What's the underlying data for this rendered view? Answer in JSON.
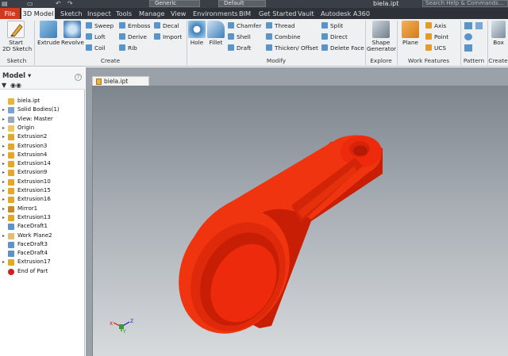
{
  "titlebar": {
    "quick_access": [
      "▤",
      "▭",
      "↶",
      "↷"
    ],
    "material": "Generic",
    "appearance": "Default",
    "doc_title": "biela.ipt",
    "search_placeholder": "Search Help & Commands..."
  },
  "tabs": [
    {
      "label": "File"
    },
    {
      "label": "3D Model"
    },
    {
      "label": "Sketch"
    },
    {
      "label": "Inspect"
    },
    {
      "label": "Tools"
    },
    {
      "label": "Manage"
    },
    {
      "label": "View"
    },
    {
      "label": "Environments"
    },
    {
      "label": "BIM"
    },
    {
      "label": "Get Started"
    },
    {
      "label": "Vault"
    },
    {
      "label": "Autodesk A360"
    }
  ],
  "ribbon": {
    "sketch": {
      "start": "Start",
      "sketch2d": "2D Sketch",
      "panel": "Sketch"
    },
    "create": {
      "extrude": "Extrude",
      "revolve": "Revolve",
      "sweep": "Sweep",
      "loft": "Loft",
      "coil": "Coil",
      "emboss": "Emboss",
      "derive": "Derive",
      "rib": "Rib",
      "decal": "Decal",
      "import": "Import",
      "panel": "Create"
    },
    "modify": {
      "hole": "Hole",
      "fillet": "Fillet",
      "chamfer": "Chamfer",
      "shell": "Shell",
      "draft": "Draft",
      "thread": "Thread",
      "combine": "Combine",
      "thicken": "Thicken/ Offset",
      "split": "Split",
      "direct": "Direct",
      "delete_face": "Delete Face",
      "panel": "Modify"
    },
    "explore": {
      "shape_generator_1": "Shape",
      "shape_generator_2": "Generator",
      "panel": "Explore"
    },
    "work": {
      "plane": "Plane",
      "axis": "Axis",
      "point": "Point",
      "ucs": "UCS",
      "panel": "Work Features"
    },
    "pattern": {
      "panel": "Pattern"
    },
    "create_freeform": {
      "box": "Box",
      "panel": "Create"
    }
  },
  "browser": {
    "title": "Model",
    "help": "?",
    "items": [
      {
        "label": "biela.ipt",
        "icon": "part-icon",
        "expand": ""
      },
      {
        "label": "Solid Bodies(1)",
        "icon": "solid-bodies-icon",
        "expand": "▸"
      },
      {
        "label": "View: Master",
        "icon": "view-icon",
        "expand": "▸"
      },
      {
        "label": "Origin",
        "icon": "folder-icon",
        "expand": "▸"
      },
      {
        "label": "Extrusion2",
        "icon": "extrusion-icon",
        "expand": "▸"
      },
      {
        "label": "Extrusion3",
        "icon": "extrusion-icon",
        "expand": "▸"
      },
      {
        "label": "Extrusion4",
        "icon": "extrusion-icon",
        "expand": "▸"
      },
      {
        "label": "Extrusion14",
        "icon": "extrusion-icon",
        "expand": "▸"
      },
      {
        "label": "Extrusion9",
        "icon": "extrusion-icon",
        "expand": "▸"
      },
      {
        "label": "Extrusion10",
        "icon": "extrusion-icon",
        "expand": "▸"
      },
      {
        "label": "Extrusion15",
        "icon": "extrusion-icon",
        "expand": "▸"
      },
      {
        "label": "Extrusion16",
        "icon": "extrusion-icon",
        "expand": "▸"
      },
      {
        "label": "Mirror1",
        "icon": "mirror-icon",
        "expand": "▸"
      },
      {
        "label": "Extrusion13",
        "icon": "extrusion-icon",
        "expand": "▸"
      },
      {
        "label": "FaceDraft1",
        "icon": "facedraft-icon",
        "expand": ""
      },
      {
        "label": "Work Plane2",
        "icon": "workplane-icon",
        "expand": "▸"
      },
      {
        "label": "FaceDraft3",
        "icon": "facedraft-icon",
        "expand": ""
      },
      {
        "label": "FaceDraft4",
        "icon": "facedraft-icon",
        "expand": ""
      },
      {
        "label": "Extrusion17",
        "icon": "extrusion-icon",
        "expand": "▸"
      },
      {
        "label": "End of Part",
        "icon": "end-of-part-icon",
        "expand": ""
      }
    ]
  },
  "document_tab": {
    "label": "biela.ipt"
  },
  "viewport": {
    "model_color": "#ee2a0d",
    "axis_labels": {
      "x": "X",
      "y": "Y",
      "z": "Z"
    }
  },
  "colors": {
    "accent_file": "#d23a1f",
    "tab_bar": "#2e3238",
    "ribbon_bg": "#eef0f2"
  }
}
